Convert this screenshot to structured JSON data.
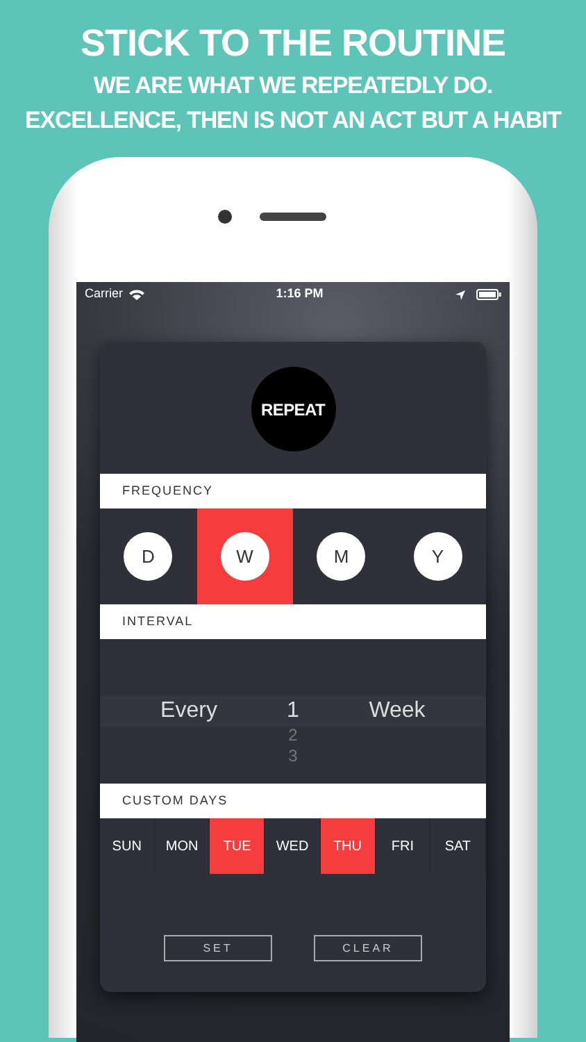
{
  "headline": "STICK TO THE ROUTINE",
  "tagline": [
    "WE ARE WHAT WE REPEATEDLY DO.",
    "EXCELLENCE, THEN IS NOT AN ACT BUT A HABIT"
  ],
  "status_bar": {
    "carrier": "Carrier",
    "time": "1:16 PM"
  },
  "repeat_badge": "REPEAT",
  "frequency": {
    "title": "FREQUENCY",
    "options": [
      {
        "label": "D",
        "selected": false
      },
      {
        "label": "W",
        "selected": true
      },
      {
        "label": "M",
        "selected": false
      },
      {
        "label": "Y",
        "selected": false
      }
    ]
  },
  "interval": {
    "title": "INTERVAL",
    "prefix": "Every",
    "values": [
      {
        "label": "1",
        "selected": true
      },
      {
        "label": "2",
        "selected": false
      },
      {
        "label": "3",
        "selected": false
      }
    ],
    "unit": "Week"
  },
  "custom_days": {
    "title": "CUSTOM DAYS",
    "days": [
      {
        "label": "SUN",
        "selected": false
      },
      {
        "label": "MON",
        "selected": false
      },
      {
        "label": "TUE",
        "selected": true
      },
      {
        "label": "WED",
        "selected": false
      },
      {
        "label": "THU",
        "selected": true
      },
      {
        "label": "FRI",
        "selected": false
      },
      {
        "label": "SAT",
        "selected": false
      }
    ]
  },
  "buttons": [
    "SET",
    "CLEAR"
  ]
}
